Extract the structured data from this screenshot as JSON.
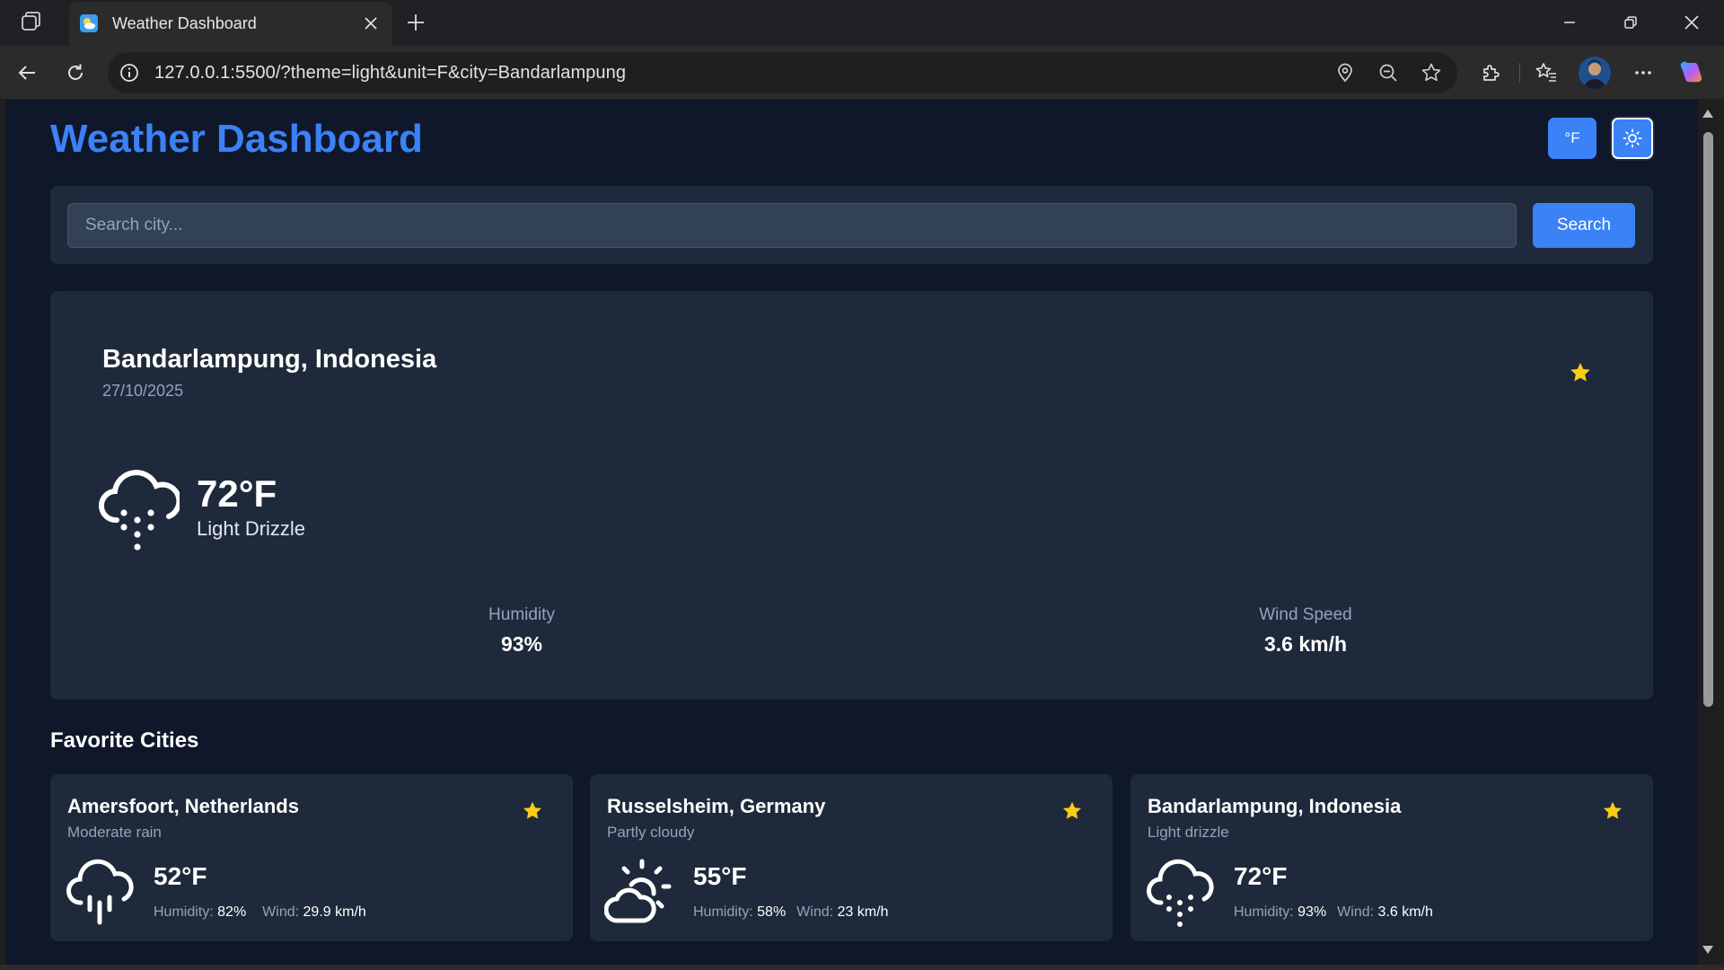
{
  "browser": {
    "tab_title": "Weather Dashboard",
    "url": "127.0.0.1:5500/?theme=light&unit=F&city=Bandarlampung"
  },
  "app": {
    "title": "Weather Dashboard",
    "unit_toggle_label": "°F",
    "theme_icon": "sun-icon"
  },
  "search": {
    "placeholder": "Search city...",
    "value": "",
    "button_label": "Search"
  },
  "current": {
    "city": "Bandarlampung, Indonesia",
    "date": "27/10/2025",
    "temperature": "72°F",
    "condition": "Light Drizzle",
    "icon": "drizzle-icon",
    "is_favorite": true,
    "humidity_label": "Humidity",
    "humidity_value": "93%",
    "wind_label": "Wind Speed",
    "wind_value": "3.6 km/h"
  },
  "favorites": {
    "heading": "Favorite Cities",
    "humidity_prefix": "Humidity:",
    "wind_prefix": "Wind:",
    "items": [
      {
        "city": "Amersfoort, Netherlands",
        "condition": "Moderate rain",
        "temperature": "52°F",
        "humidity": "82%",
        "wind": "29.9 km/h",
        "icon": "rain-icon"
      },
      {
        "city": "Russelsheim, Germany",
        "condition": "Partly cloudy",
        "temperature": "55°F",
        "humidity": "58%",
        "wind": "23 km/h",
        "icon": "partly-cloudy-icon"
      },
      {
        "city": "Bandarlampung, Indonesia",
        "condition": "Light drizzle",
        "temperature": "72°F",
        "humidity": "93%",
        "wind": "3.6 km/h",
        "icon": "drizzle-icon"
      }
    ]
  },
  "colors": {
    "accent": "#3b82f6",
    "background": "#0f172a",
    "card": "#1e293b",
    "star": "#facc15"
  }
}
